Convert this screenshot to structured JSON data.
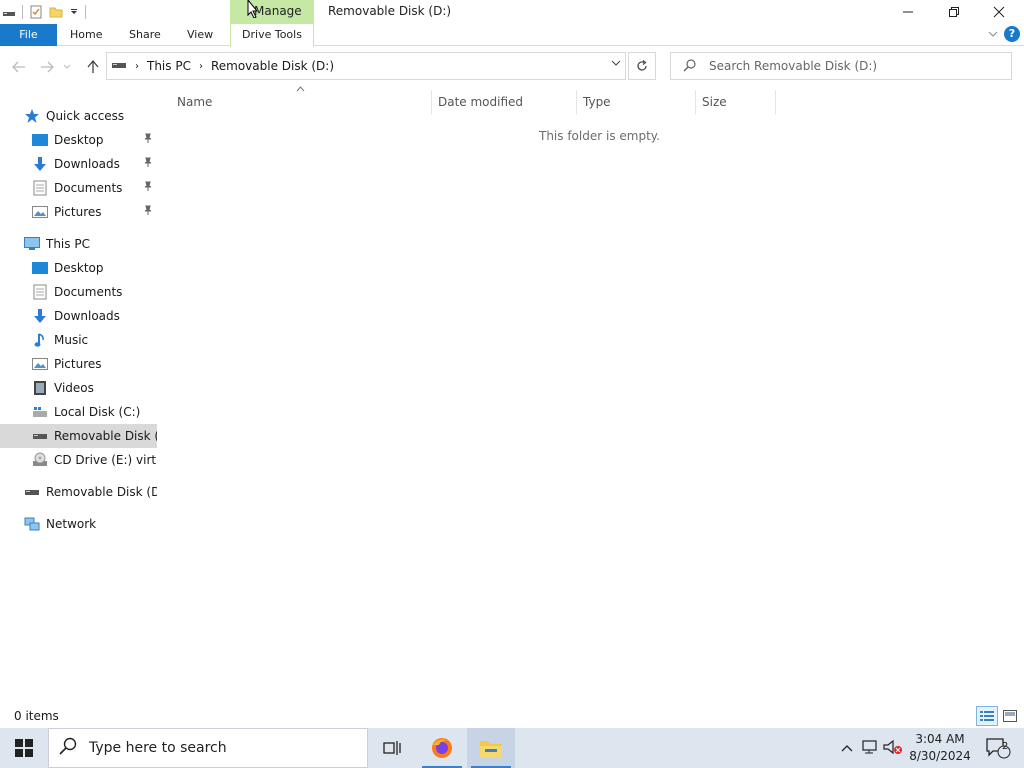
{
  "window": {
    "title": "Removable Disk (D:)",
    "context_tab": "Manage",
    "minimize": "—",
    "restore": "❐",
    "close": "✕"
  },
  "ribbon": {
    "tabs": [
      {
        "label": "File"
      },
      {
        "label": "Home"
      },
      {
        "label": "Share"
      },
      {
        "label": "View"
      },
      {
        "label": "Drive Tools"
      }
    ]
  },
  "address": {
    "crumbs": [
      "This PC",
      "Removable Disk (D:)"
    ],
    "search_placeholder": "Search Removable Disk (D:)"
  },
  "nav": {
    "quick_access": "Quick access",
    "quick_items": [
      "Desktop",
      "Downloads",
      "Documents",
      "Pictures"
    ],
    "this_pc": "This PC",
    "pc_items": [
      "Desktop",
      "Documents",
      "Downloads",
      "Music",
      "Pictures",
      "Videos",
      "Local Disk (C:)",
      "Removable Disk (D:)",
      "CD Drive (E:) virtio-win"
    ],
    "removable": "Removable Disk (D:)",
    "network": "Network"
  },
  "columns": [
    "Name",
    "Date modified",
    "Type",
    "Size"
  ],
  "empty_message": "This folder is empty.",
  "status": {
    "items": "0 items"
  },
  "taskbar": {
    "search_placeholder": "Type here to search",
    "time": "3:04 AM",
    "date": "8/30/2024",
    "notifications": "2"
  },
  "colors": {
    "accent": "#1979ca",
    "manage_tab": "#c5e9a4",
    "taskbar": "#dde5ef",
    "selected": "#d9d9d9"
  }
}
